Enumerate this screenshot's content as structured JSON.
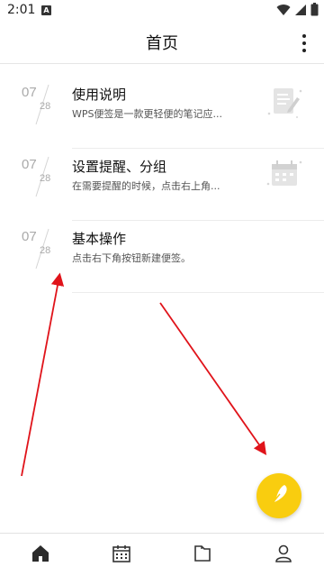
{
  "status_bar": {
    "time": "2:01",
    "notification_badge": "A",
    "icons": [
      "wifi-icon",
      "signal-icon",
      "battery-icon"
    ]
  },
  "header": {
    "title": "首页",
    "more_icon": "more-vertical-icon"
  },
  "notes": [
    {
      "month": "07",
      "day": "28",
      "title": "使用说明",
      "preview": "WPS便签是一款更轻便的笔记应...",
      "thumb_icon": "note-edit-icon"
    },
    {
      "month": "07",
      "day": "28",
      "title": "设置提醒、分组",
      "preview": "在需要提醒的时候，点击右上角...",
      "thumb_icon": "calendar-icon"
    },
    {
      "month": "07",
      "day": "28",
      "title": "基本操作",
      "preview": "点击右下角按钮新建便签。",
      "thumb_icon": ""
    }
  ],
  "fab": {
    "icon": "feather-pen-icon",
    "color": "#f9cd0f"
  },
  "bottom_nav": {
    "items": [
      {
        "icon": "home-icon",
        "active": true
      },
      {
        "icon": "calendar-icon",
        "active": false
      },
      {
        "icon": "folder-icon",
        "active": false
      },
      {
        "icon": "profile-icon",
        "active": false
      }
    ]
  },
  "annotation_color": "#e0131a"
}
